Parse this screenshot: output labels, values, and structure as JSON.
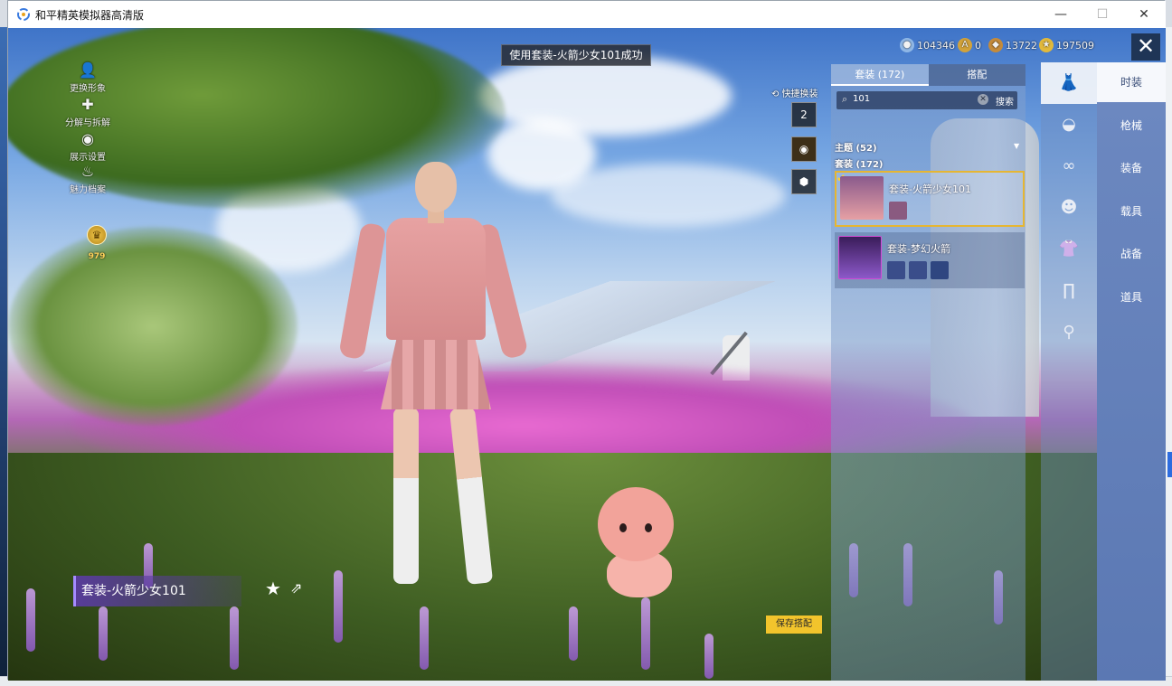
{
  "window": {
    "title": "和平精英模拟器高清版",
    "min": "—",
    "max": "☐",
    "close": "✕"
  },
  "toast": "使用套装-火箭少女101成功",
  "left_menu": [
    {
      "label": "更换形象",
      "icon": "person-icon",
      "glyph": "👤"
    },
    {
      "label": "分解与拆解",
      "icon": "puzzle-icon",
      "glyph": "✚"
    },
    {
      "label": "展示设置",
      "icon": "eye-icon",
      "glyph": "◉"
    },
    {
      "label": "魅力档案",
      "icon": "flame-icon",
      "glyph": "♨"
    }
  ],
  "charm_badge": {
    "value": "979"
  },
  "currencies": [
    {
      "name": "globe-coin-icon",
      "value": "104346",
      "color": "#8fb7e6"
    },
    {
      "name": "a-coin-icon",
      "value": "0",
      "color": "#d2a23a"
    },
    {
      "name": "crest-coin-icon",
      "value": "13722",
      "color": "#c58b3a"
    },
    {
      "name": "star-coin-icon",
      "value": "197509",
      "color": "#e2b93b"
    }
  ],
  "quick_change": {
    "label": "快捷换装",
    "slot1": "2"
  },
  "panel": {
    "tabs": [
      "套装 (172)",
      "搭配"
    ],
    "search": {
      "value": "101",
      "button": "搜索",
      "clear": "✕"
    },
    "theme_row": "主题 (52)",
    "suit_row": "套装 (172)",
    "cards": [
      {
        "name": "套装-火箭少女101"
      },
      {
        "name": "套装-梦幻火箭"
      }
    ]
  },
  "categories": [
    "时装",
    "枪械",
    "装备",
    "载具",
    "战备",
    "道具"
  ],
  "outfit_name": "套装-火箭少女101",
  "save_button": "保存搭配",
  "colors": {
    "accent": "#f2c42c",
    "panel_blue": "#5b78b3",
    "selected_border": "#e6b632"
  }
}
